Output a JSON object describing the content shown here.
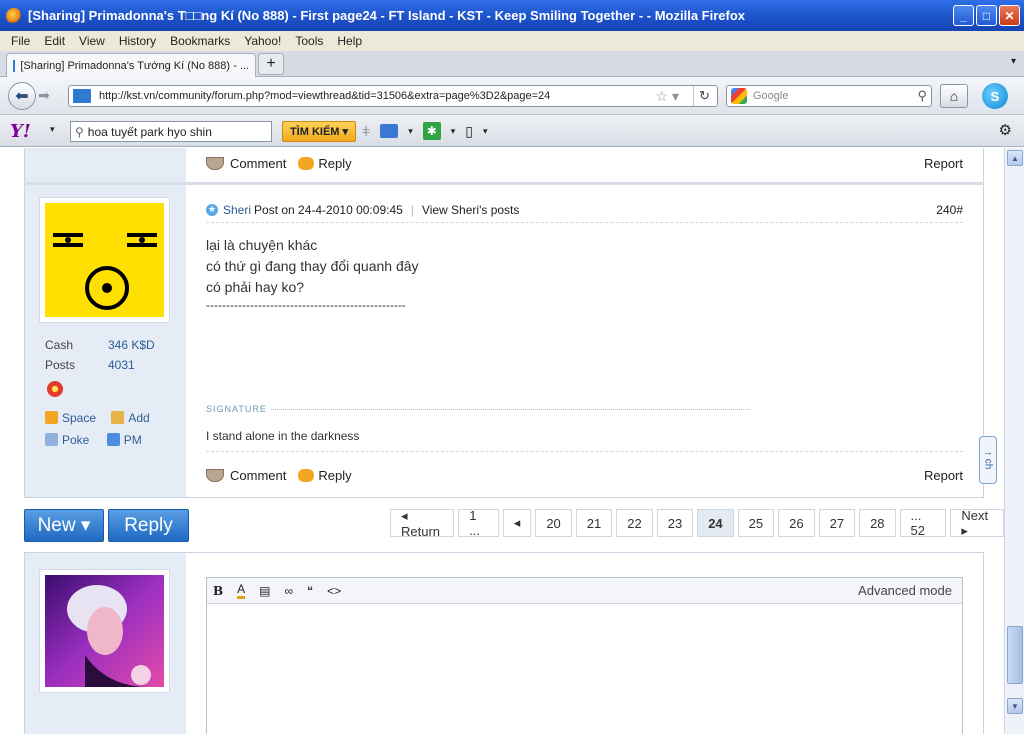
{
  "window": {
    "title": "[Sharing] Primadonna's T□□ng Kí (No 888) - First page24 - FT Island - KST - Keep Smiling Together - - Mozilla Firefox"
  },
  "menu": [
    "File",
    "Edit",
    "View",
    "History",
    "Bookmarks",
    "Yahoo!",
    "Tools",
    "Help"
  ],
  "tab": {
    "label": "[Sharing] Primadonna's Tướng Kí (No 888) - ...",
    "new_tab": "+"
  },
  "nav": {
    "url": "http://kst.vn/community/forum.php?mod=viewthread&tid=31506&extra=page%3D2&page=24",
    "search_placeholder": "Google"
  },
  "yahoo": {
    "logo": "Y!",
    "search_value": "hoa tuyết park hyo shin",
    "search_button": "TÌM KIẾM ▾"
  },
  "prev_post_actions": {
    "comment": "Comment",
    "reply": "Reply",
    "report": "Report"
  },
  "post": {
    "author": "Sheri",
    "posted": "Post on 24-4-2010 00:09:45",
    "view_posts": "View Sheri's posts",
    "floor": "240#",
    "lines": [
      "lại là chuyện khác",
      "có thứ gì đang thay đổi quanh đây",
      "có phải hay ko?",
      "--------------------------------------------------"
    ],
    "signature_label": "SIGNATURE",
    "signature": "I stand alone in the darkness",
    "stats": [
      {
        "label": "Cash",
        "value": "346 K$D"
      },
      {
        "label": "Posts",
        "value": "4031"
      }
    ],
    "links": {
      "space": "Space",
      "add": "Add",
      "poke": "Poke",
      "pm": "PM"
    },
    "actions": {
      "comment": "Comment",
      "reply": "Reply",
      "report": "Report"
    }
  },
  "buttons": {
    "new": "New ▾",
    "reply": "Reply"
  },
  "pager": {
    "return": "◂ Return",
    "first": "1 ...",
    "prev": "◂",
    "pages": [
      "20",
      "21",
      "22",
      "23",
      "24",
      "25",
      "26",
      "27",
      "28"
    ],
    "current": "24",
    "last": "... 52",
    "next": "Next ▸"
  },
  "editor": {
    "tools": [
      "B",
      "A",
      "▤",
      "∞",
      "“",
      "<>"
    ],
    "advanced": "Advanced mode"
  },
  "fixed_tab": "↑ ch"
}
